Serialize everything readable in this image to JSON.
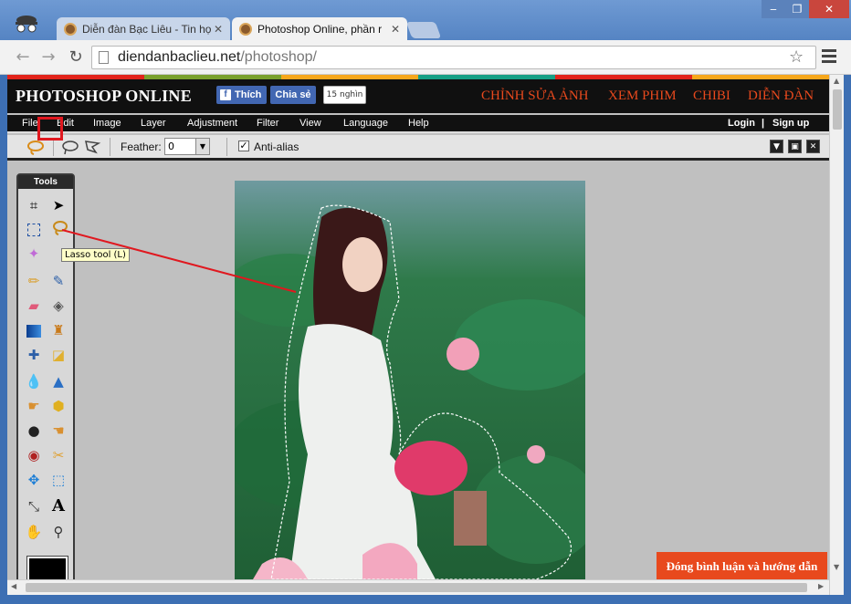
{
  "browser": {
    "tabs": [
      {
        "label": "Diễn đàn Bạc Liêu - Tin họ"
      },
      {
        "label": "Photoshop Online, phần r"
      }
    ],
    "url_domain": "diendanbaclieu.net",
    "url_path": "/photoshop/"
  },
  "site": {
    "title": "PHOTOSHOP ONLINE",
    "fb_like": "Thích",
    "fb_share": "Chia sẻ",
    "fb_count": "15 nghìn",
    "nav": [
      "CHỈNH SỬA ẢNH",
      "XEM PHIM",
      "CHIBI",
      "DIỄN ĐÀN"
    ],
    "strip_colors": [
      "#e2231a",
      "#7aa12c",
      "#f7a71b",
      "#16a085",
      "#e2231a",
      "#f7a71b"
    ]
  },
  "menu": {
    "items": [
      "File",
      "Edit",
      "Image",
      "Layer",
      "Adjustment",
      "Filter",
      "View",
      "Language",
      "Help"
    ],
    "login": "Login",
    "divider": "|",
    "signup": "Sign up"
  },
  "options": {
    "feather_label": "Feather:",
    "feather_value": "0",
    "antialias_label": "Anti-alias",
    "antialias_checked": true
  },
  "tools": {
    "title": "Tools",
    "tooltip": "Lasso tool (L)",
    "active": "lasso-tool"
  },
  "footer": {
    "comment_button": "Đóng bình luận và hướng dẫn"
  },
  "colors": {
    "accent": "#e8491d",
    "fb": "#4267b2",
    "highlight": "#e0181f"
  }
}
